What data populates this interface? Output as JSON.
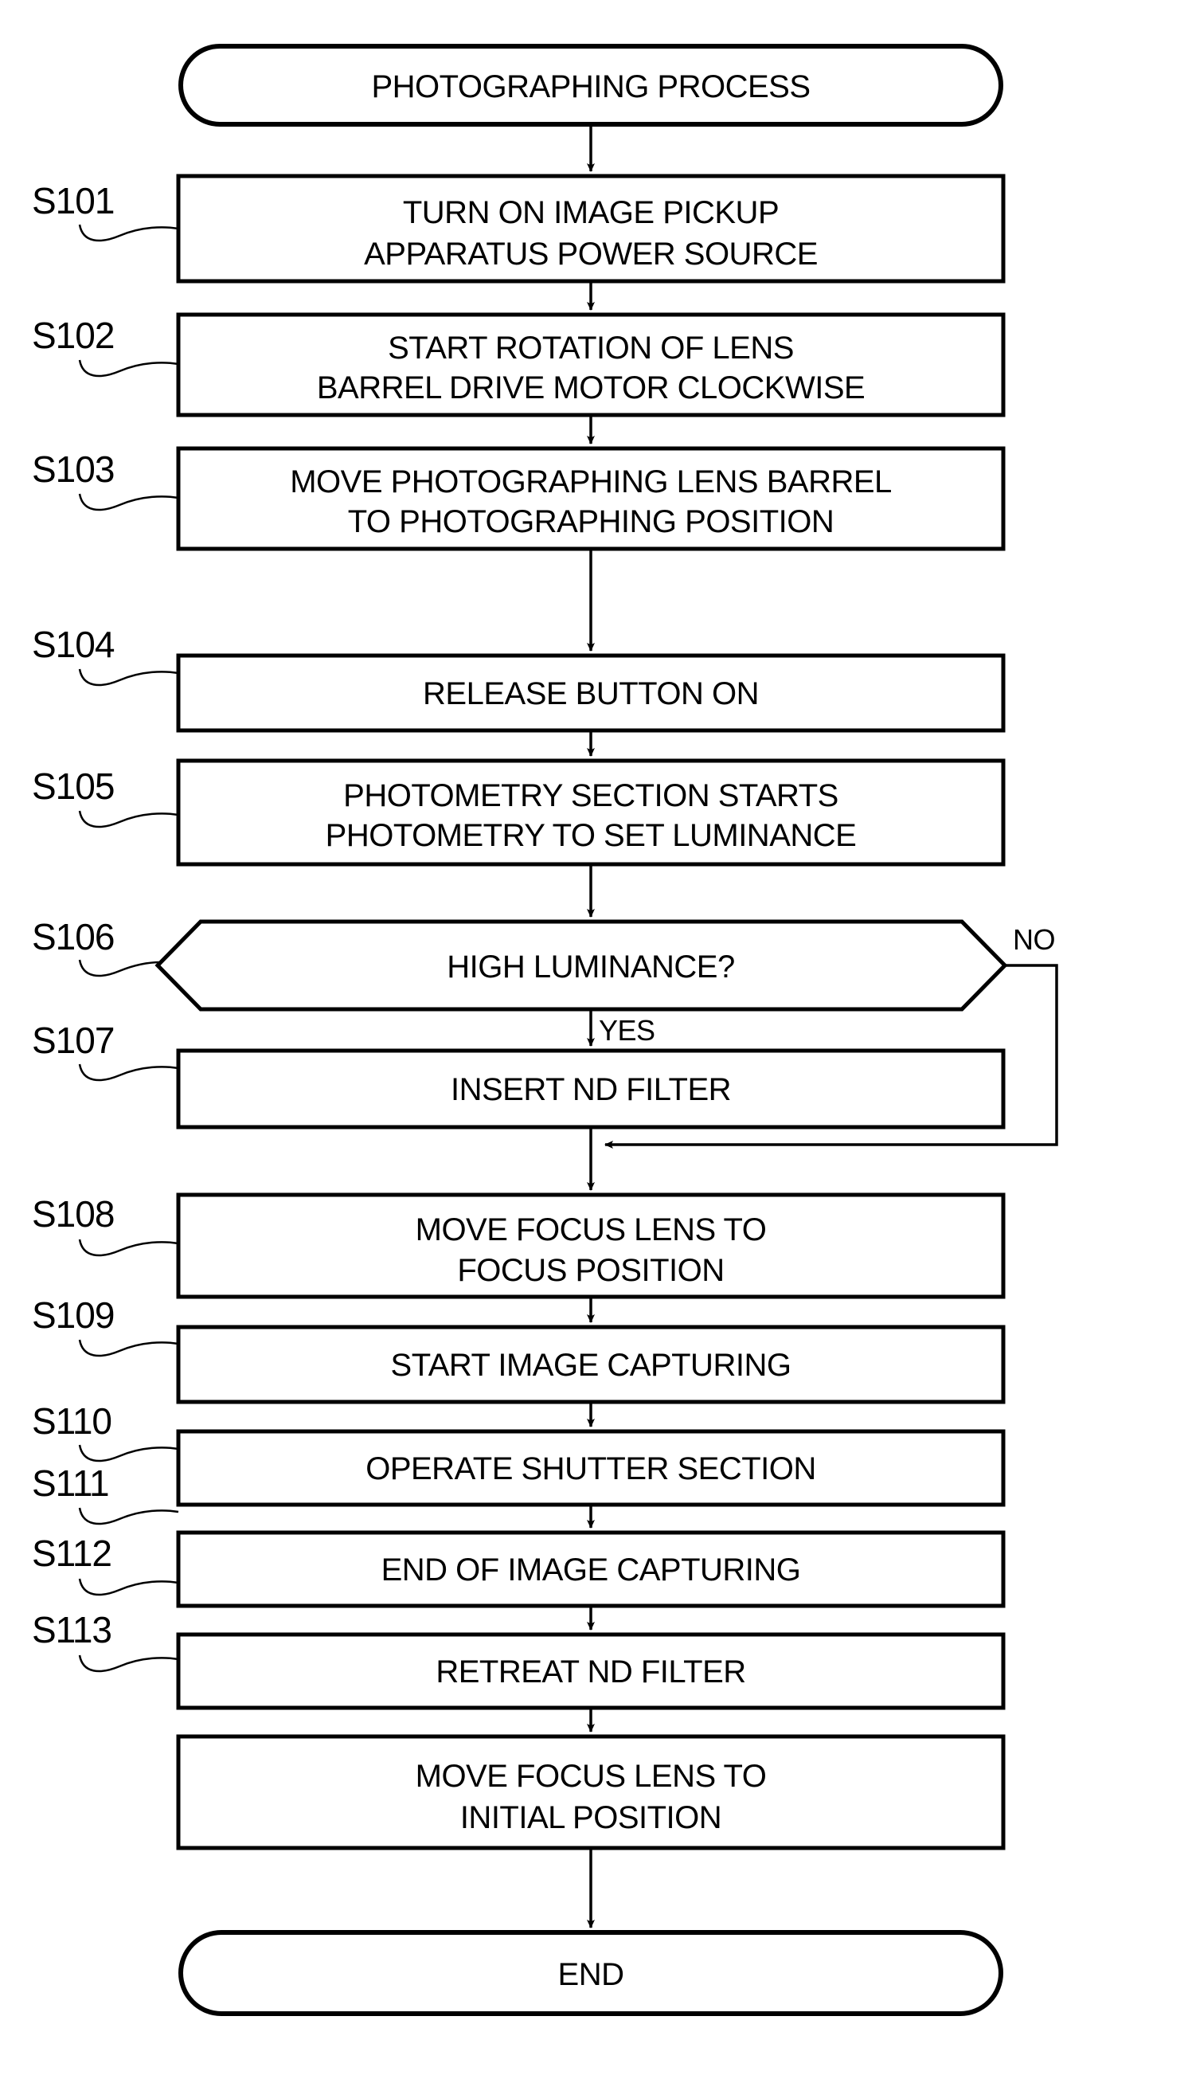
{
  "diagram": {
    "title": "PHOTOGRAPHING PROCESS FLOWCHART",
    "type": "flowchart",
    "orientation": "vertical",
    "colors": {
      "stroke": "#000000",
      "fill": "#ffffff",
      "text": "#000000"
    },
    "start": {
      "id": "start",
      "shape": "stadium",
      "label": "PHOTOGRAPHING PROCESS"
    },
    "end": {
      "id": "end",
      "shape": "stadium",
      "label": "END"
    },
    "steps": [
      {
        "id": "s101",
        "ref": "S101",
        "shape": "process",
        "lines": [
          "TURN ON IMAGE PICKUP",
          "APPARATUS POWER SOURCE"
        ]
      },
      {
        "id": "s102",
        "ref": "S102",
        "shape": "process",
        "lines": [
          "START ROTATION OF LENS",
          "BARREL DRIVE MOTOR CLOCKWISE"
        ]
      },
      {
        "id": "s103",
        "ref": "S103",
        "shape": "process",
        "lines": [
          "MOVE PHOTOGRAPHING LENS BARREL",
          "TO PHOTOGRAPHING POSITION"
        ]
      },
      {
        "id": "s104",
        "ref": "S104",
        "shape": "process",
        "lines": [
          "RELEASE BUTTON ON"
        ]
      },
      {
        "id": "s105",
        "ref": "S105",
        "shape": "process",
        "lines": [
          "PHOTOMETRY SECTION STARTS",
          "PHOTOMETRY TO SET LUMINANCE"
        ]
      },
      {
        "id": "s106",
        "ref": "S106",
        "shape": "decision",
        "lines": [
          "HIGH LUMINANCE?"
        ],
        "branch_yes": "YES",
        "branch_no": "NO"
      },
      {
        "id": "s107",
        "ref": "S107",
        "shape": "process",
        "lines": [
          "INSERT ND FILTER"
        ]
      },
      {
        "id": "s108",
        "ref": "S108",
        "shape": "process",
        "lines": [
          "MOVE FOCUS LENS TO",
          "FOCUS POSITION"
        ]
      },
      {
        "id": "s109",
        "ref": "S109",
        "shape": "process",
        "lines": [
          "START IMAGE CAPTURING"
        ]
      },
      {
        "id": "s110",
        "ref": "S110",
        "shape": "process",
        "lines": [
          "OPERATE SHUTTER SECTION"
        ]
      },
      {
        "id": "s111",
        "ref": "S111",
        "shape": "process",
        "lines": [
          "END OF IMAGE CAPTURING"
        ]
      },
      {
        "id": "s112",
        "ref": "S112",
        "shape": "process",
        "lines": [
          "RETREAT ND FILTER"
        ]
      },
      {
        "id": "s113",
        "ref": "S113",
        "shape": "process",
        "lines": [
          "MOVE FOCUS LENS TO",
          "INITIAL POSITION"
        ]
      }
    ]
  }
}
